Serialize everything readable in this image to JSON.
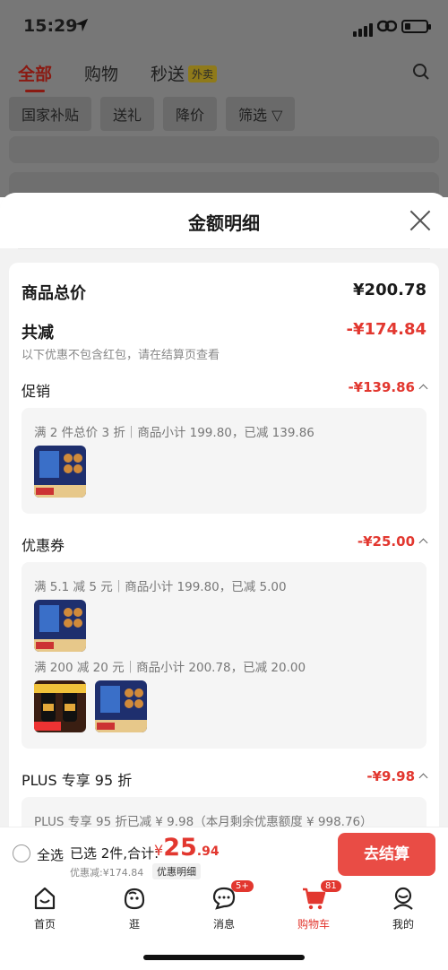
{
  "status": {
    "time": "15:29"
  },
  "bg": {
    "tabs": [
      "全部",
      "购物",
      "秒送"
    ],
    "tab_badge": "外卖",
    "chips": [
      "国家补贴",
      "送礼",
      "降价",
      "筛选"
    ]
  },
  "sheet": {
    "title": "金额明细",
    "total_label": "商品总价",
    "total_value": "¥200.78",
    "reduce_label": "共减",
    "reduce_value": "-¥174.84",
    "note": "以下优惠不包含红包，请在结算页查看",
    "promo": {
      "label": "促销",
      "value": "-¥139.86",
      "line": "满 2 件总价 3 折｜商品小计 199.80，已减 139.86"
    },
    "coupon": {
      "label": "优惠券",
      "value": "-¥25.00",
      "line1": "满 5.1 减 5 元｜商品小计 199.80，已减 5.00",
      "line2": "满 200 减 20 元｜商品小计 200.78，已减 20.00"
    },
    "plus": {
      "label": "PLUS 专享 95 折",
      "value": "-¥9.98",
      "line": "PLUS 专享 95 折已减 ¥ 9.98（本月剩余优惠额度 ¥ 998.76）"
    }
  },
  "checkout": {
    "select_all": "全选",
    "selected": "已选 2件,合计:",
    "total_symbol": "¥",
    "total_int": "25",
    "total_dec": ".94",
    "discount": "优惠减:¥174.84",
    "detail": "优惠明细",
    "pay": "去结算"
  },
  "tabs": [
    {
      "label": "首页"
    },
    {
      "label": "逛"
    },
    {
      "label": "消息",
      "badge": "5+"
    },
    {
      "label": "购物车",
      "badge": "81"
    },
    {
      "label": "我的"
    }
  ],
  "colors": {
    "accent": "#e2372f",
    "pay": "#e94c45"
  }
}
